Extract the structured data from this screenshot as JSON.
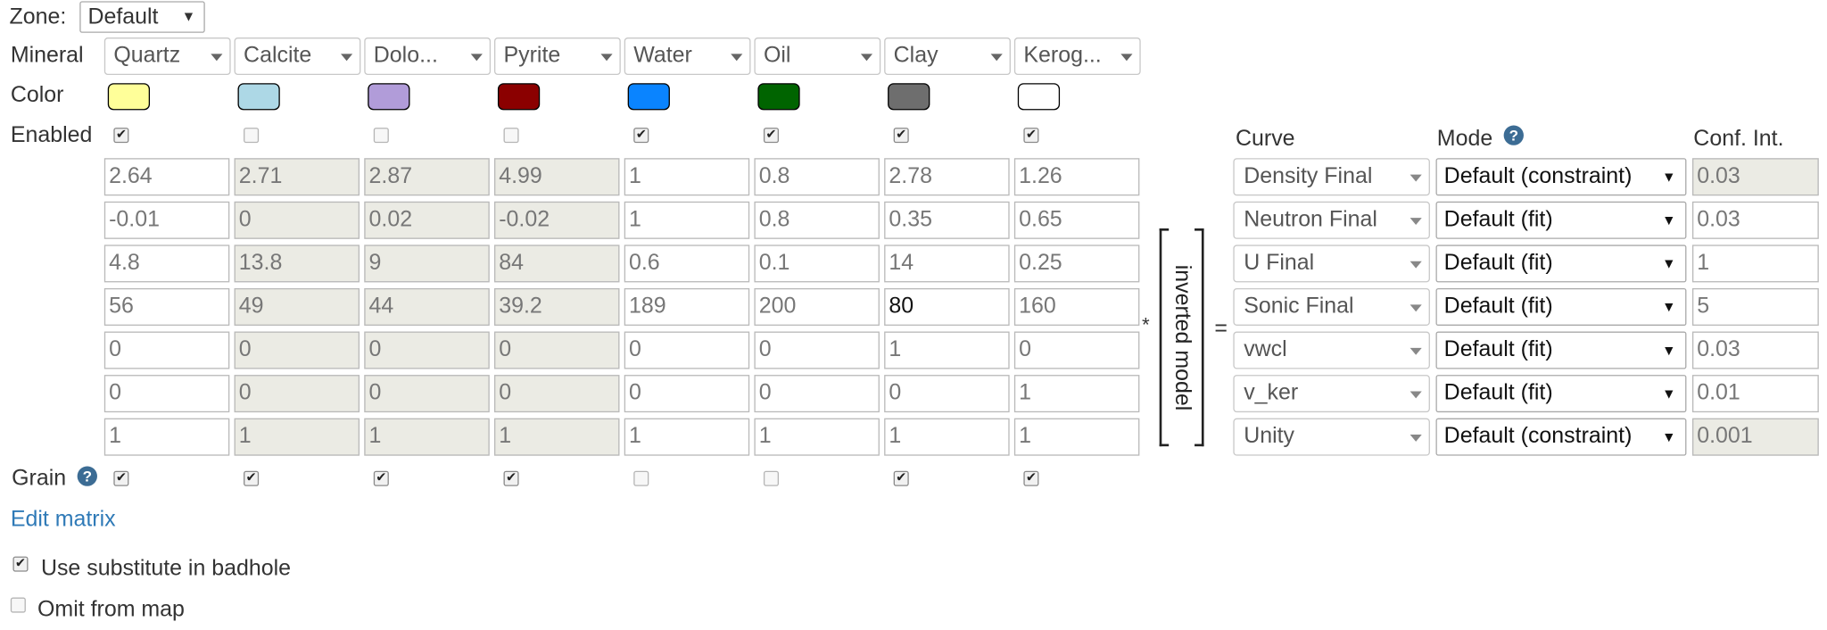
{
  "zone": {
    "label": "Zone:",
    "value": "Default"
  },
  "labels": {
    "mineral": "Mineral",
    "color": "Color",
    "enabled": "Enabled",
    "grain": "Grain"
  },
  "minerals": [
    {
      "name": "Quartz",
      "color": "#FFFF99",
      "enabled": true,
      "grain": true
    },
    {
      "name": "Calcite",
      "color": "#ADD8E6",
      "enabled": false,
      "grain": true
    },
    {
      "name": "Dolo...",
      "color": "#B19CD9",
      "enabled": false,
      "grain": true
    },
    {
      "name": "Pyrite",
      "color": "#8B0000",
      "enabled": false,
      "grain": true
    },
    {
      "name": "Water",
      "color": "#0A84FF",
      "enabled": true,
      "grain": false
    },
    {
      "name": "Oil",
      "color": "#006400",
      "enabled": true,
      "grain": false
    },
    {
      "name": "Clay",
      "color": "#6E6E6E",
      "enabled": true,
      "grain": true
    },
    {
      "name": "Kerog...",
      "color": "#FFFFFF",
      "enabled": true,
      "grain": true
    }
  ],
  "matrix": [
    [
      "2.64",
      "2.71",
      "2.87",
      "4.99",
      "1",
      "0.8",
      "2.78",
      "1.26"
    ],
    [
      "-0.01",
      "0",
      "0.02",
      "-0.02",
      "1",
      "0.8",
      "0.35",
      "0.65"
    ],
    [
      "4.8",
      "13.8",
      "9",
      "84",
      "0.6",
      "0.1",
      "14",
      "0.25"
    ],
    [
      "56",
      "49",
      "44",
      "39.2",
      "189",
      "200",
      "80",
      "160"
    ],
    [
      "0",
      "0",
      "0",
      "0",
      "0",
      "0",
      "1",
      "0"
    ],
    [
      "0",
      "0",
      "0",
      "0",
      "0",
      "0",
      "0",
      "1"
    ],
    [
      "1",
      "1",
      "1",
      "1",
      "1",
      "1",
      "1",
      "1"
    ]
  ],
  "operators": {
    "times": "*",
    "equals": "="
  },
  "model_label": "inverted model",
  "curves_header": {
    "curve": "Curve",
    "mode": "Mode",
    "conf": "Conf. Int."
  },
  "curves": [
    {
      "curve": "Density Final",
      "mode": "Default (constraint)",
      "conf": "0.03"
    },
    {
      "curve": "Neutron Final",
      "mode": "Default (fit)",
      "conf": "0.03"
    },
    {
      "curve": "U Final",
      "mode": "Default (fit)",
      "conf": "1"
    },
    {
      "curve": "Sonic Final",
      "mode": "Default (fit)",
      "conf": "5"
    },
    {
      "curve": "vwcl",
      "mode": "Default (fit)",
      "conf": "0.03"
    },
    {
      "curve": "v_ker",
      "mode": "Default (fit)",
      "conf": "0.01"
    },
    {
      "curve": "Unity",
      "mode": "Default (constraint)",
      "conf": "0.001"
    }
  ],
  "edit_matrix": "Edit matrix",
  "options": [
    {
      "label": "Use substitute in badhole",
      "checked": true
    },
    {
      "label": "Omit from map",
      "checked": false
    }
  ]
}
